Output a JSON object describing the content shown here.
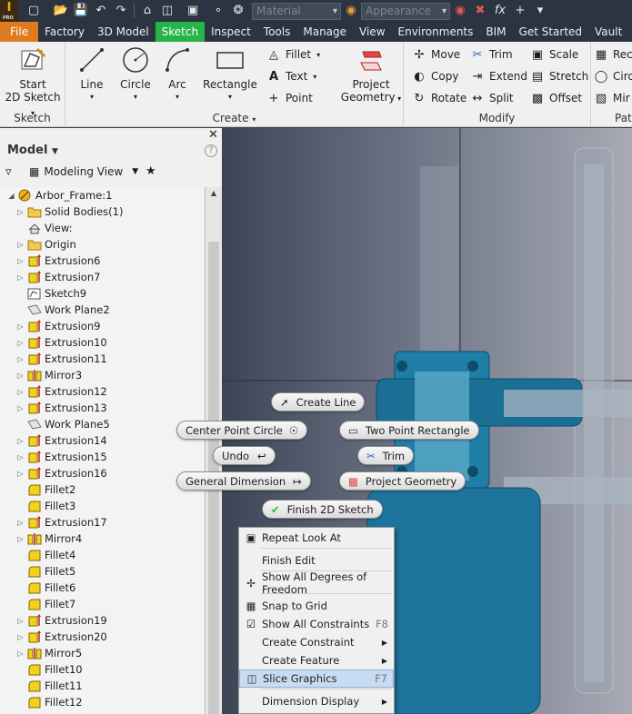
{
  "qat": {
    "material": "Material",
    "appearance": "Appearance"
  },
  "tabs": [
    "File",
    "Factory",
    "3D Model",
    "Sketch",
    "Inspect",
    "Tools",
    "Manage",
    "View",
    "Environments",
    "BIM",
    "Get Started",
    "Vault"
  ],
  "ribbon": {
    "sketch_group": {
      "label": "Sketch",
      "start": "Start\n2D Sketch"
    },
    "create_group": {
      "label": "Create",
      "line": "Line",
      "circle": "Circle",
      "arc": "Arc",
      "rectangle": "Rectangle",
      "fillet": "Fillet",
      "text": "Text",
      "point": "Point",
      "project_geometry": "Project\nGeometry"
    },
    "modify_group": {
      "label": "Modify",
      "move": "Move",
      "copy": "Copy",
      "rotate": "Rotate",
      "trim": "Trim",
      "extend": "Extend",
      "split": "Split",
      "scale": "Scale",
      "stretch": "Stretch",
      "offset": "Offset"
    },
    "pattern_group": {
      "label": "Pat",
      "rect": "Rec",
      "circ": "Circ",
      "mirror": "Mir"
    }
  },
  "panel": {
    "title": "Model",
    "modeling_view": "Modeling View"
  },
  "tree": [
    {
      "label": "Arbor_Frame:1",
      "icon": "assembly",
      "expand": "open"
    },
    {
      "label": "Solid Bodies(1)",
      "icon": "folder",
      "expand": "closed"
    },
    {
      "label": "View:",
      "icon": "view",
      "expand": ""
    },
    {
      "label": "Origin",
      "icon": "folder",
      "expand": "closed"
    },
    {
      "label": "Extrusion6",
      "icon": "extrude",
      "expand": "closed"
    },
    {
      "label": "Extrusion7",
      "icon": "extrude",
      "expand": "closed"
    },
    {
      "label": "Sketch9",
      "icon": "sketch",
      "expand": ""
    },
    {
      "label": "Work Plane2",
      "icon": "plane",
      "expand": ""
    },
    {
      "label": "Extrusion9",
      "icon": "extrude",
      "expand": "closed"
    },
    {
      "label": "Extrusion10",
      "icon": "extrude",
      "expand": "closed"
    },
    {
      "label": "Extrusion11",
      "icon": "extrude",
      "expand": "closed"
    },
    {
      "label": "Mirror3",
      "icon": "mirror",
      "expand": "closed"
    },
    {
      "label": "Extrusion12",
      "icon": "extrude",
      "expand": "closed"
    },
    {
      "label": "Extrusion13",
      "icon": "extrude",
      "expand": "closed"
    },
    {
      "label": "Work Plane5",
      "icon": "plane",
      "expand": ""
    },
    {
      "label": "Extrusion14",
      "icon": "extrude",
      "expand": "closed"
    },
    {
      "label": "Extrusion15",
      "icon": "extrude",
      "expand": "closed"
    },
    {
      "label": "Extrusion16",
      "icon": "extrude",
      "expand": "closed"
    },
    {
      "label": "Fillet2",
      "icon": "fillet",
      "expand": ""
    },
    {
      "label": "Fillet3",
      "icon": "fillet",
      "expand": ""
    },
    {
      "label": "Extrusion17",
      "icon": "extrude",
      "expand": "closed"
    },
    {
      "label": "Mirror4",
      "icon": "mirror",
      "expand": "closed"
    },
    {
      "label": "Fillet4",
      "icon": "fillet",
      "expand": ""
    },
    {
      "label": "Fillet5",
      "icon": "fillet",
      "expand": ""
    },
    {
      "label": "Fillet6",
      "icon": "fillet",
      "expand": ""
    },
    {
      "label": "Fillet7",
      "icon": "fillet",
      "expand": ""
    },
    {
      "label": "Extrusion19",
      "icon": "extrude",
      "expand": "closed"
    },
    {
      "label": "Extrusion20",
      "icon": "extrude",
      "expand": "closed"
    },
    {
      "label": "Mirror5",
      "icon": "mirror",
      "expand": "closed"
    },
    {
      "label": "Fillet10",
      "icon": "fillet",
      "expand": ""
    },
    {
      "label": "Fillet11",
      "icon": "fillet",
      "expand": ""
    },
    {
      "label": "Fillet12",
      "icon": "fillet",
      "expand": ""
    }
  ],
  "marking_menu": {
    "create_line": "Create Line",
    "center_point_circle": "Center Point Circle",
    "two_point_rectangle": "Two Point Rectangle",
    "undo": "Undo",
    "trim": "Trim",
    "general_dimension": "General Dimension",
    "project_geometry": "Project Geometry",
    "finish_2d_sketch": "Finish 2D Sketch"
  },
  "context_menu": [
    {
      "label": "Repeat Look At",
      "shortcut": "",
      "submenu": false,
      "icon": "look-at"
    },
    {
      "label": "Finish Edit",
      "shortcut": "",
      "submenu": false,
      "icon": ""
    },
    {
      "label": "Show All Degrees of Freedom",
      "shortcut": "",
      "submenu": false,
      "icon": "dof"
    },
    {
      "label": "Snap to Grid",
      "shortcut": "",
      "submenu": false,
      "icon": "grid"
    },
    {
      "label": "Show All Constraints",
      "shortcut": "F8",
      "submenu": false,
      "icon": "constraints"
    },
    {
      "label": "Create Constraint",
      "shortcut": "",
      "submenu": true,
      "icon": ""
    },
    {
      "label": "Create Feature",
      "shortcut": "",
      "submenu": true,
      "icon": ""
    },
    {
      "label": "Slice Graphics",
      "shortcut": "F7",
      "submenu": false,
      "icon": "slice",
      "highlighted": true
    },
    {
      "label": "Dimension Display",
      "shortcut": "",
      "submenu": true,
      "icon": ""
    }
  ],
  "colors": {
    "accent_green": "#27b34a",
    "file_orange": "#e07a1f",
    "part_teal": "#1f7ea6",
    "extrude_yellow": "#f2d21c"
  }
}
